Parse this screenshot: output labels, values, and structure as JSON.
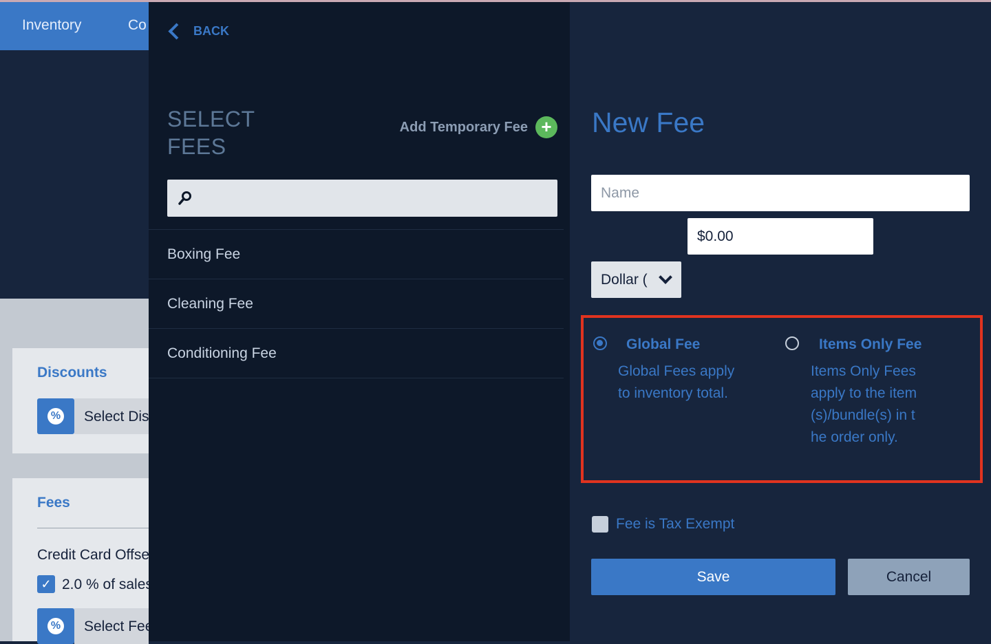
{
  "background": {
    "nav": {
      "items": [
        "Inventory",
        "Co"
      ]
    },
    "discounts": {
      "title": "Discounts",
      "select_label": "Select Dis"
    },
    "fees": {
      "title": "Fees",
      "item_label": "Credit Card Offse",
      "item_detail": "2.0 % of sales",
      "select_label": "Select Fee"
    }
  },
  "drawer": {
    "back_label": "BACK",
    "title": "SELECT FEES",
    "add_temp_label": "Add Temporary Fee",
    "search_placeholder": "",
    "fees": [
      {
        "label": "Boxing Fee"
      },
      {
        "label": "Cleaning Fee"
      },
      {
        "label": "Conditioning Fee"
      }
    ]
  },
  "form": {
    "title": "New Fee",
    "name_placeholder": "Name",
    "name_value": "",
    "amount_value": "$0.00",
    "type_selected": "Dollar (",
    "options": {
      "global": {
        "label": "Global Fee",
        "desc": "Global Fees apply to inventory total.",
        "selected": true
      },
      "items_only": {
        "label": "Items Only Fee",
        "desc": "Items Only Fees apply to the item(s)/bundle(s) in the order only.",
        "selected": false
      }
    },
    "tax_exempt_label": "Fee is Tax Exempt",
    "tax_exempt_checked": false,
    "save_label": "Save",
    "cancel_label": "Cancel"
  },
  "colors": {
    "accent": "#3a78c6",
    "highlight_border": "#e0331f",
    "drawer_bg": "#0d1829",
    "form_bg": "#17253d",
    "add_icon": "#5cb85c"
  },
  "icons": {
    "back": "chevron-left-icon",
    "add": "plus-circle-icon",
    "search": "search-icon",
    "dropdown": "chevron-down-icon",
    "discount": "percent-badge-icon",
    "check": "checkmark-icon"
  }
}
